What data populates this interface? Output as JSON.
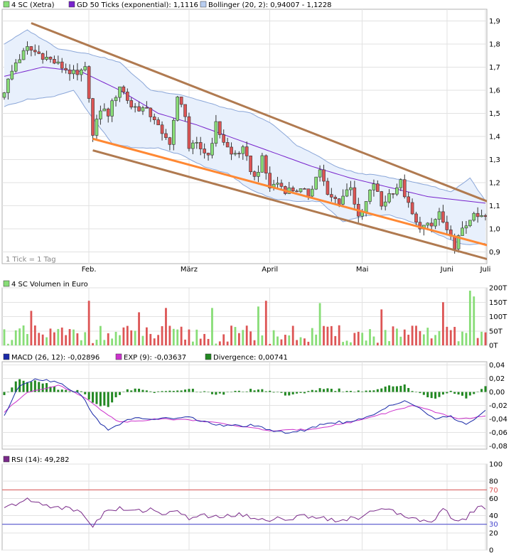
{
  "legend": {
    "price_label": "4 SC (Xetra)",
    "ma_label": "GD 50 Ticks (exponential): 1,1116",
    "boll_label": "Bollinger (20, 2): 0,94007 - 1,1228",
    "volume_label": "4 SC Volumen in Euro",
    "macd_label": "MACD (26, 12): -0,02896",
    "exp_label": "EXP (9): -0,03637",
    "div_label": "Divergence: 0,00741",
    "rsi_label": "RSI (14): 49,282",
    "tick_note": "1 Tick = 1 Tag"
  },
  "colors": {
    "up": "#88dd77",
    "down": "#dd5555",
    "ma": "#7722cc",
    "boll_fill": "#e8f0fc",
    "boll_line": "#8aa6d8",
    "channel": "#b07a50",
    "support": "#ff8833",
    "macd": "#1a2aa8",
    "exp": "#cc33cc",
    "divergence": "#228822",
    "rsi": "#7a2a8a",
    "rsi70": "#dd5555",
    "rsi30": "#4444cc"
  },
  "chart_data": [
    {
      "type": "candlestick",
      "x_labels": [
        "Feb.",
        "März",
        "April",
        "Mai",
        "Juni",
        "Juli"
      ],
      "y_ticks": [
        "1,9",
        "1,8",
        "1,7",
        "1,6",
        "1,5",
        "1,4",
        "1,3",
        "1,2",
        "1,1",
        "1,0",
        "0,9"
      ],
      "ylim": [
        0.85,
        1.95
      ],
      "n_ticks": 126,
      "month_starts": [
        22,
        48,
        69,
        93,
        115,
        125
      ],
      "anchors": [
        [
          0,
          1.6
        ],
        [
          3,
          1.72
        ],
        [
          6,
          1.78
        ],
        [
          10,
          1.75
        ],
        [
          13,
          1.72
        ],
        [
          16,
          1.69
        ],
        [
          19,
          1.66
        ],
        [
          21,
          1.69
        ],
        [
          22,
          1.58
        ],
        [
          23,
          1.4
        ],
        [
          25,
          1.52
        ],
        [
          27,
          1.5
        ],
        [
          30,
          1.62
        ],
        [
          33,
          1.53
        ],
        [
          36,
          1.52
        ],
        [
          39,
          1.48
        ],
        [
          41,
          1.4
        ],
        [
          43,
          1.38
        ],
        [
          45,
          1.56
        ],
        [
          47,
          1.5
        ],
        [
          48,
          1.35
        ],
        [
          50,
          1.36
        ],
        [
          53,
          1.32
        ],
        [
          55,
          1.45
        ],
        [
          57,
          1.38
        ],
        [
          59,
          1.32
        ],
        [
          62,
          1.34
        ],
        [
          65,
          1.22
        ],
        [
          67,
          1.3
        ],
        [
          69,
          1.18
        ],
        [
          71,
          1.2
        ],
        [
          73,
          1.17
        ],
        [
          76,
          1.17
        ],
        [
          79,
          1.15
        ],
        [
          82,
          1.26
        ],
        [
          84,
          1.14
        ],
        [
          87,
          1.12
        ],
        [
          90,
          1.19
        ],
        [
          92,
          1.04
        ],
        [
          93,
          1.07
        ],
        [
          96,
          1.2
        ],
        [
          98,
          1.1
        ],
        [
          100,
          1.15
        ],
        [
          103,
          1.2
        ],
        [
          105,
          1.1
        ],
        [
          107,
          1.02
        ],
        [
          109,
          1.01
        ],
        [
          111,
          1.01
        ],
        [
          113,
          1.07
        ],
        [
          115,
          0.98
        ],
        [
          117,
          0.93
        ],
        [
          119,
          0.99
        ],
        [
          121,
          1.05
        ],
        [
          125,
          1.05
        ]
      ],
      "ma_anchors": [
        [
          0,
          1.66
        ],
        [
          10,
          1.7
        ],
        [
          20,
          1.68
        ],
        [
          30,
          1.6
        ],
        [
          40,
          1.5
        ],
        [
          50,
          1.45
        ],
        [
          60,
          1.39
        ],
        [
          70,
          1.33
        ],
        [
          80,
          1.27
        ],
        [
          90,
          1.22
        ],
        [
          100,
          1.18
        ],
        [
          110,
          1.14
        ],
        [
          125,
          1.1116
        ]
      ],
      "boll_upper": [
        [
          0,
          1.8
        ],
        [
          6,
          1.86
        ],
        [
          14,
          1.78
        ],
        [
          21,
          1.76
        ],
        [
          26,
          1.74
        ],
        [
          30,
          1.72
        ],
        [
          38,
          1.6
        ],
        [
          46,
          1.58
        ],
        [
          52,
          1.55
        ],
        [
          58,
          1.52
        ],
        [
          64,
          1.5
        ],
        [
          70,
          1.45
        ],
        [
          76,
          1.36
        ],
        [
          80,
          1.33
        ],
        [
          86,
          1.27
        ],
        [
          92,
          1.24
        ],
        [
          98,
          1.23
        ],
        [
          104,
          1.21
        ],
        [
          110,
          1.19
        ],
        [
          116,
          1.16
        ],
        [
          121,
          1.22
        ],
        [
          125,
          1.12
        ]
      ],
      "boll_lower": [
        [
          0,
          1.53
        ],
        [
          6,
          1.56
        ],
        [
          12,
          1.57
        ],
        [
          18,
          1.6
        ],
        [
          22,
          1.5
        ],
        [
          28,
          1.37
        ],
        [
          34,
          1.35
        ],
        [
          40,
          1.35
        ],
        [
          46,
          1.32
        ],
        [
          52,
          1.27
        ],
        [
          58,
          1.24
        ],
        [
          64,
          1.17
        ],
        [
          70,
          1.13
        ],
        [
          76,
          1.12
        ],
        [
          82,
          1.12
        ],
        [
          88,
          1.03
        ],
        [
          94,
          1.06
        ],
        [
          100,
          1.06
        ],
        [
          106,
          1.03
        ],
        [
          112,
          0.98
        ],
        [
          118,
          0.94
        ],
        [
          121,
          0.93
        ],
        [
          125,
          0.94
        ]
      ],
      "trend_channel_upper": [
        [
          7,
          1.89
        ],
        [
          125,
          1.12
        ]
      ],
      "trend_support": [
        [
          23,
          1.39
        ],
        [
          125,
          0.93
        ]
      ],
      "trend_channel_lower": [
        [
          23,
          1.34
        ],
        [
          125,
          0.87
        ]
      ]
    },
    {
      "type": "bar",
      "title": "4 SC Volumen in Euro",
      "y_ticks": [
        "200T",
        "150T",
        "100T",
        "50T",
        "0T"
      ],
      "ylim": [
        0,
        200
      ],
      "unit": "T (thousand EUR)",
      "high_peaks": [
        [
          7,
          120
        ],
        [
          22,
          155
        ],
        [
          35,
          115
        ],
        [
          42,
          130
        ],
        [
          54,
          130
        ],
        [
          66,
          135
        ],
        [
          68,
          155
        ],
        [
          82,
          147
        ],
        [
          98,
          125
        ],
        [
          114,
          150
        ],
        [
          121,
          190
        ],
        [
          122,
          170
        ]
      ]
    },
    {
      "type": "line",
      "title": "MACD",
      "y_ticks": [
        "0,04",
        "0,02",
        "0,00",
        "-0,02",
        "-0,04",
        "-0,06",
        "-0,08"
      ],
      "ylim": [
        -0.085,
        0.045
      ],
      "macd_anchors": [
        [
          0,
          -0.035
        ],
        [
          4,
          0.01
        ],
        [
          8,
          0.02
        ],
        [
          14,
          0.015
        ],
        [
          20,
          -0.005
        ],
        [
          24,
          -0.04
        ],
        [
          27,
          -0.058
        ],
        [
          32,
          -0.04
        ],
        [
          40,
          -0.04
        ],
        [
          48,
          -0.038
        ],
        [
          56,
          -0.05
        ],
        [
          64,
          -0.05
        ],
        [
          72,
          -0.06
        ],
        [
          78,
          -0.058
        ],
        [
          84,
          -0.045
        ],
        [
          90,
          -0.045
        ],
        [
          96,
          -0.035
        ],
        [
          100,
          -0.02
        ],
        [
          104,
          -0.012
        ],
        [
          108,
          -0.025
        ],
        [
          112,
          -0.04
        ],
        [
          116,
          -0.037
        ],
        [
          120,
          -0.048
        ],
        [
          125,
          -0.02896
        ]
      ],
      "exp_anchors": [
        [
          0,
          -0.03
        ],
        [
          6,
          0.0
        ],
        [
          14,
          0.01
        ],
        [
          20,
          -0.005
        ],
        [
          26,
          -0.03
        ],
        [
          30,
          -0.045
        ],
        [
          40,
          -0.04
        ],
        [
          50,
          -0.042
        ],
        [
          60,
          -0.05
        ],
        [
          70,
          -0.058
        ],
        [
          80,
          -0.055
        ],
        [
          90,
          -0.045
        ],
        [
          100,
          -0.03
        ],
        [
          106,
          -0.02
        ],
        [
          112,
          -0.03
        ],
        [
          118,
          -0.04
        ],
        [
          125,
          -0.03637
        ]
      ],
      "latest_divergence": 0.00741
    },
    {
      "type": "line",
      "title": "RSI (14)",
      "y_ticks": [
        "100",
        "80",
        "70",
        "60",
        "40",
        "30",
        "20",
        "0"
      ],
      "ylim": [
        0,
        100
      ],
      "reference_lines": [
        70,
        30
      ],
      "rsi_anchors": [
        [
          0,
          48
        ],
        [
          3,
          54
        ],
        [
          6,
          58
        ],
        [
          10,
          53
        ],
        [
          14,
          50
        ],
        [
          18,
          47
        ],
        [
          20,
          43
        ],
        [
          22,
          34
        ],
        [
          23,
          28
        ],
        [
          26,
          44
        ],
        [
          30,
          48
        ],
        [
          34,
          45
        ],
        [
          38,
          48
        ],
        [
          42,
          42
        ],
        [
          46,
          44
        ],
        [
          48,
          37
        ],
        [
          52,
          40
        ],
        [
          56,
          38
        ],
        [
          60,
          42
        ],
        [
          64,
          38
        ],
        [
          68,
          36
        ],
        [
          72,
          36
        ],
        [
          76,
          38
        ],
        [
          80,
          40
        ],
        [
          84,
          37
        ],
        [
          88,
          34
        ],
        [
          92,
          38
        ],
        [
          96,
          48
        ],
        [
          100,
          45
        ],
        [
          104,
          40
        ],
        [
          108,
          36
        ],
        [
          112,
          34
        ],
        [
          114,
          48
        ],
        [
          116,
          40
        ],
        [
          118,
          32
        ],
        [
          120,
          38
        ],
        [
          123,
          50
        ],
        [
          125,
          49.282
        ]
      ]
    }
  ]
}
